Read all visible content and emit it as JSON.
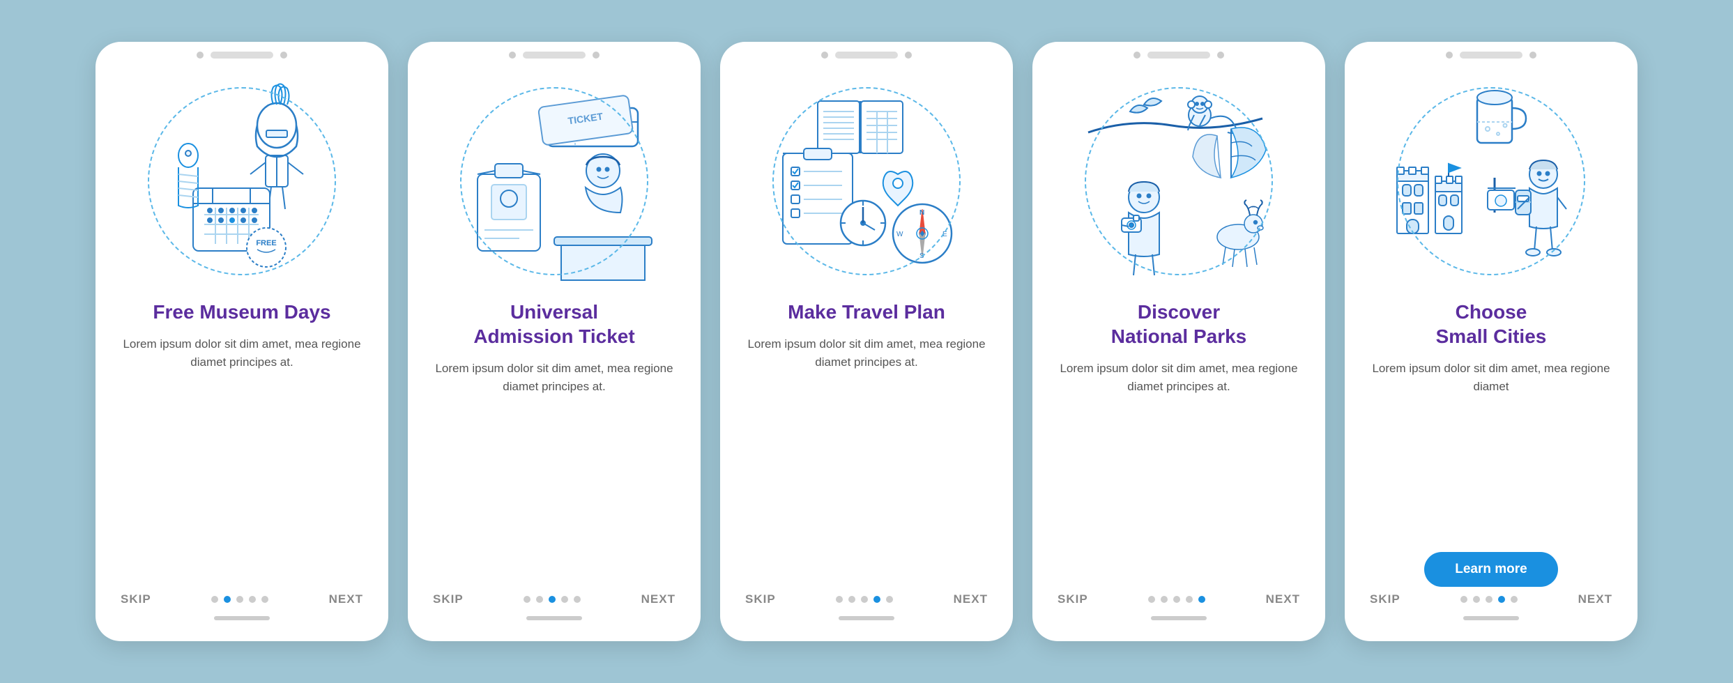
{
  "screens": [
    {
      "id": "screen-1",
      "title": "Free Museum Days",
      "body": "Lorem ipsum dolor sit dim amet, mea regione diamet principes at.",
      "nav": {
        "skip": "SKIP",
        "next": "NEXT",
        "dots": [
          false,
          true,
          false,
          false,
          false
        ],
        "active_dot": 1
      },
      "show_learn_more": false,
      "illustration": "museum"
    },
    {
      "id": "screen-2",
      "title": "Universal\nAdmission Ticket",
      "body": "Lorem ipsum dolor sit dim amet, mea regione diamet principes at.",
      "nav": {
        "skip": "SKIP",
        "next": "NEXT",
        "dots": [
          false,
          false,
          true,
          false,
          false
        ],
        "active_dot": 2
      },
      "show_learn_more": false,
      "illustration": "ticket"
    },
    {
      "id": "screen-3",
      "title": "Make Travel Plan",
      "body": "Lorem ipsum dolor sit dim amet, mea regione diamet principes at.",
      "nav": {
        "skip": "SKIP",
        "next": "NEXT",
        "dots": [
          false,
          false,
          false,
          true,
          false
        ],
        "active_dot": 3
      },
      "show_learn_more": false,
      "illustration": "travel"
    },
    {
      "id": "screen-4",
      "title": "Discover\nNational Parks",
      "body": "Lorem ipsum dolor sit dim amet, mea regione diamet principes at.",
      "nav": {
        "skip": "SKIP",
        "next": "NEXT",
        "dots": [
          false,
          false,
          false,
          false,
          true
        ],
        "active_dot": 4
      },
      "show_learn_more": false,
      "illustration": "parks"
    },
    {
      "id": "screen-5",
      "title": "Choose\nSmall Cities",
      "body": "Lorem ipsum dolor sit dim amet, mea regione diamet",
      "nav": {
        "skip": "SKIP",
        "next": "NEXT",
        "dots": [
          false,
          false,
          false,
          true,
          false
        ],
        "active_dot": 3
      },
      "show_learn_more": true,
      "learn_more_label": "Learn more",
      "illustration": "cities"
    }
  ],
  "colors": {
    "background": "#9ec5d4",
    "card_bg": "#ffffff",
    "title": "#5b2d9e",
    "body_text": "#666666",
    "nav_text": "#999999",
    "dot_active": "#1a90e0",
    "dot_inactive": "#cccccc",
    "dashed_circle": "#5bb8e8",
    "btn_bg": "#1a90e0",
    "btn_text": "#ffffff"
  }
}
